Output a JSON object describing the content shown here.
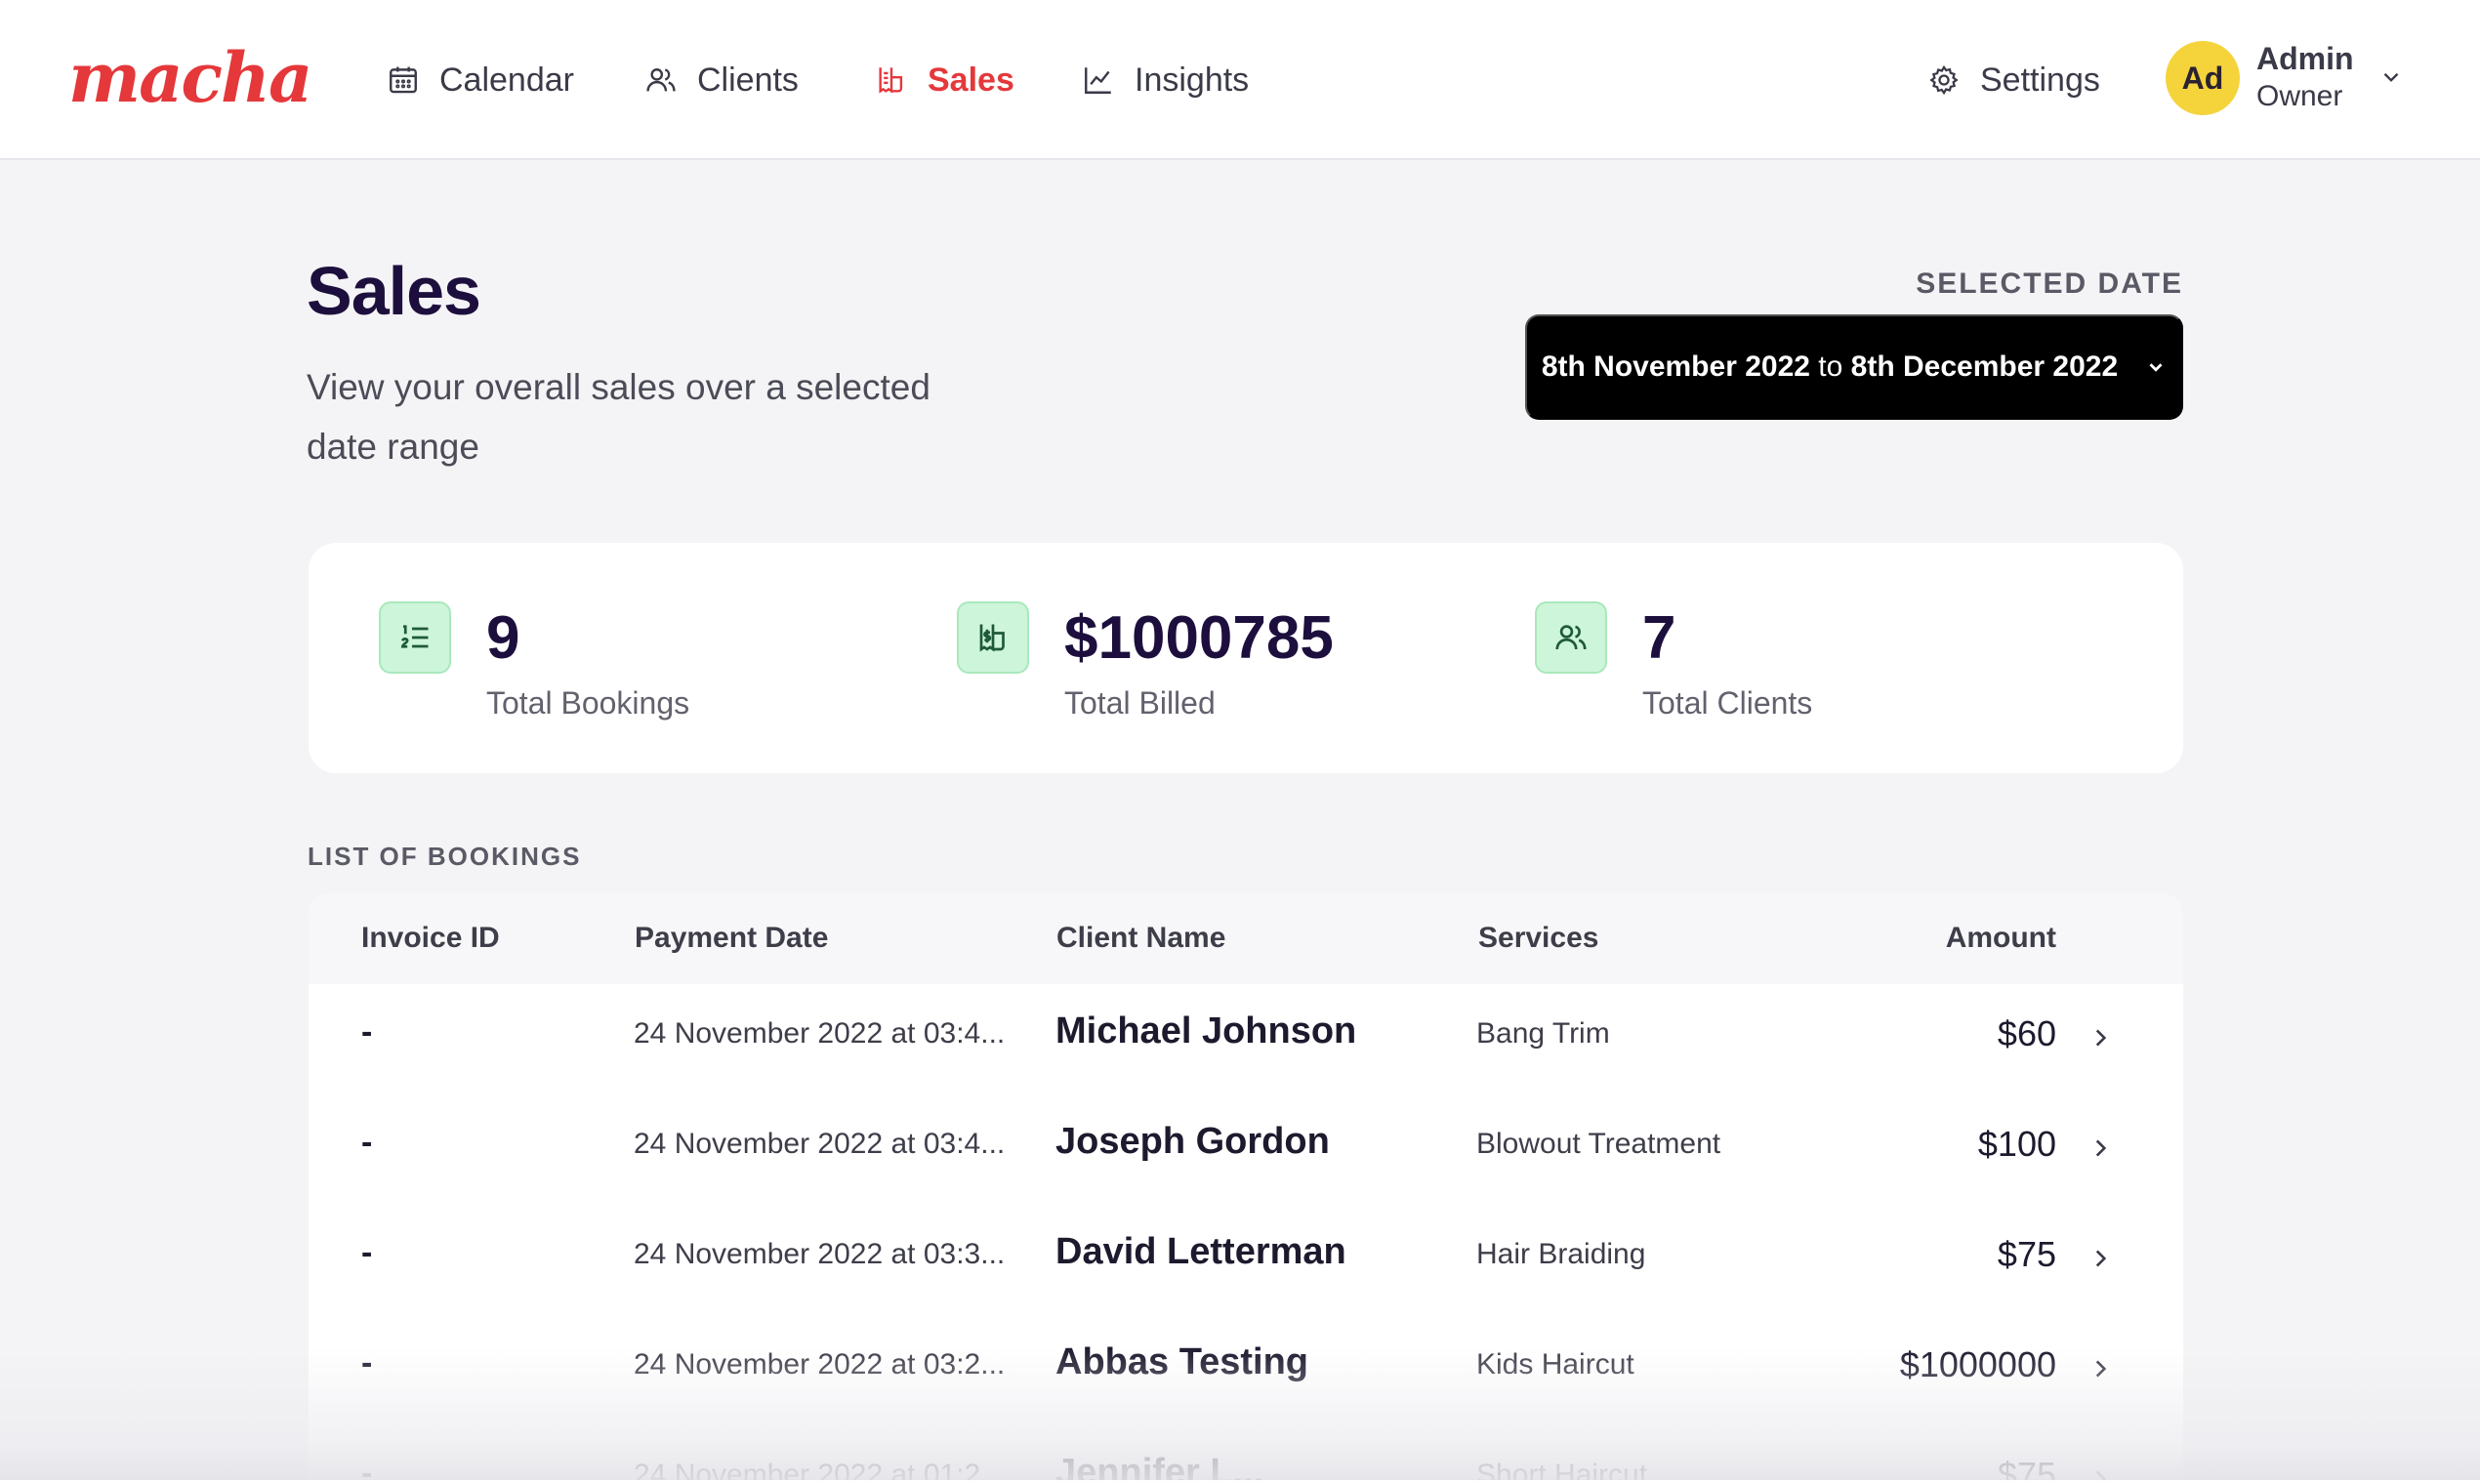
{
  "brand": {
    "logo_text": "macha",
    "accent": "#e5383b"
  },
  "nav": {
    "items": [
      {
        "label": "Calendar",
        "icon": "calendar-icon",
        "active": false
      },
      {
        "label": "Clients",
        "icon": "users-icon",
        "active": false
      },
      {
        "label": "Sales",
        "icon": "receipt-icon",
        "active": true
      },
      {
        "label": "Insights",
        "icon": "chart-line-icon",
        "active": false
      }
    ],
    "settings_label": "Settings"
  },
  "user": {
    "initials": "Ad",
    "name": "Admin",
    "role": "Owner",
    "avatar_color": "#f5d33b"
  },
  "header": {
    "title": "Sales",
    "subtitle": "View your overall sales over a selected date range",
    "selected_date_label": "SELECTED DATE",
    "date_from": "8th November 2022",
    "date_joiner": "to",
    "date_to": "8th December 2022"
  },
  "stats": {
    "bookings": {
      "value": "9",
      "label": "Total Bookings"
    },
    "billed": {
      "value": "$1000785",
      "label": "Total Billed"
    },
    "clients": {
      "value": "7",
      "label": "Total Clients"
    },
    "icon_bg": "#cdf5d9"
  },
  "bookings": {
    "section_label": "LIST OF BOOKINGS",
    "columns": {
      "invoice": "Invoice ID",
      "date": "Payment Date",
      "client": "Client Name",
      "service": "Services",
      "amount": "Amount"
    },
    "rows": [
      {
        "invoice": "-",
        "date": "24 November 2022 at 03:4...",
        "client": "Michael Johnson",
        "service": "Bang Trim",
        "amount": "$60"
      },
      {
        "invoice": "-",
        "date": "24 November 2022 at 03:4...",
        "client": "Joseph Gordon",
        "service": "Blowout Treatment",
        "amount": "$100"
      },
      {
        "invoice": "-",
        "date": "24 November 2022 at 03:3...",
        "client": "David Letterman",
        "service": "Hair Braiding",
        "amount": "$75"
      },
      {
        "invoice": "-",
        "date": "24 November 2022 at 03:2...",
        "client": "Abbas Testing",
        "service": "Kids Haircut",
        "amount": "$1000000"
      },
      {
        "invoice": "-",
        "date": "24 November 2022 at 01:2...",
        "client": "Jennifer L...",
        "service": "Short Haircut",
        "amount": "$75"
      }
    ]
  }
}
